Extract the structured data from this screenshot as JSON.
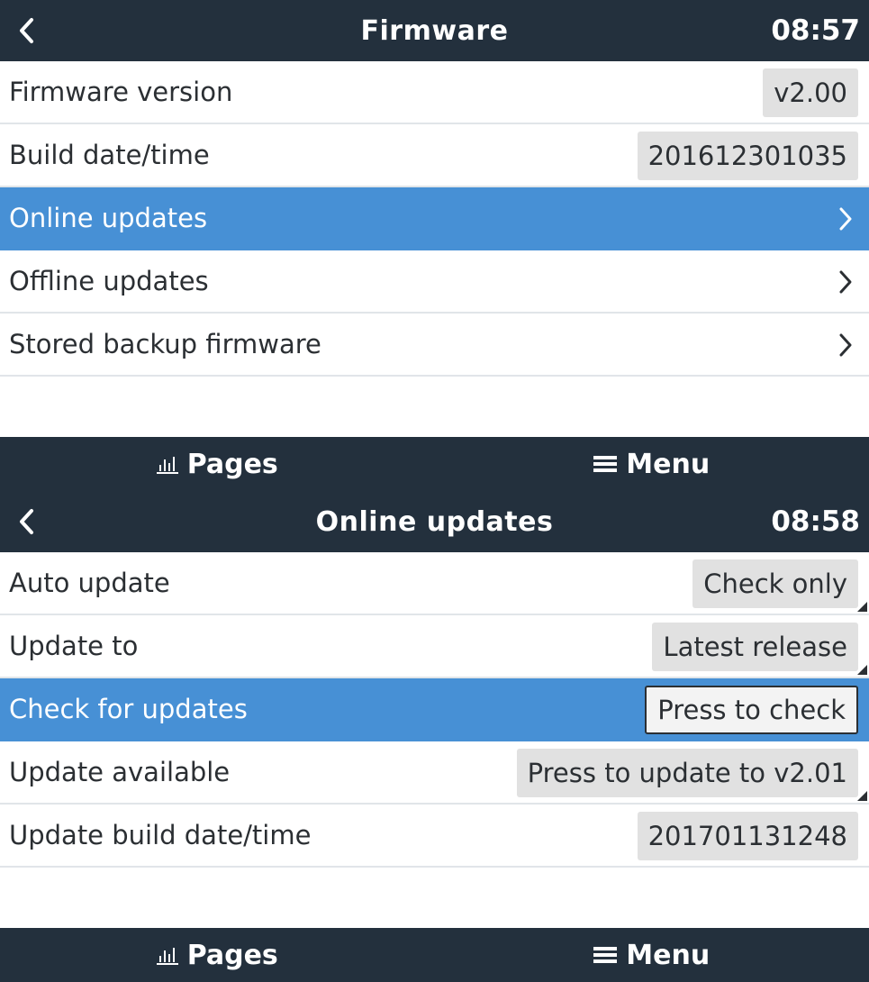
{
  "screens": [
    {
      "header": {
        "title": "Firmware",
        "time": "08:57"
      },
      "rows": [
        {
          "label": "Firmware version",
          "value": "v2.00"
        },
        {
          "label": "Build date/time",
          "value": "201612301035"
        },
        {
          "label": "Online updates",
          "selected": true,
          "chevron": true
        },
        {
          "label": "Offline updates",
          "chevron": true
        },
        {
          "label": "Stored backup firmware",
          "chevron": true
        }
      ],
      "footer": {
        "pages_label": "Pages",
        "menu_label": "Menu"
      }
    },
    {
      "header": {
        "title": "Online updates",
        "time": "08:58"
      },
      "rows": [
        {
          "label": "Auto update",
          "value": "Check only"
        },
        {
          "label": "Update to",
          "value": "Latest release"
        },
        {
          "label": "Check for updates",
          "value": "Press to check",
          "selected": true
        },
        {
          "label": "Update available",
          "value": "Press to update to v2.01"
        },
        {
          "label": "Update build date/time",
          "value": "201701131248"
        }
      ],
      "footer": {
        "pages_label": "Pages",
        "menu_label": "Menu"
      }
    }
  ],
  "colors": {
    "header_bg": "#23303d",
    "selected_bg": "#4790d5",
    "value_bg": "#e1e1e1",
    "text": "#2b2f33"
  },
  "icons": {
    "back": "chevron-left-icon",
    "row_arrow": "chevron-right-icon",
    "pages": "bar-chart-icon",
    "menu": "hamburger-menu-icon"
  }
}
